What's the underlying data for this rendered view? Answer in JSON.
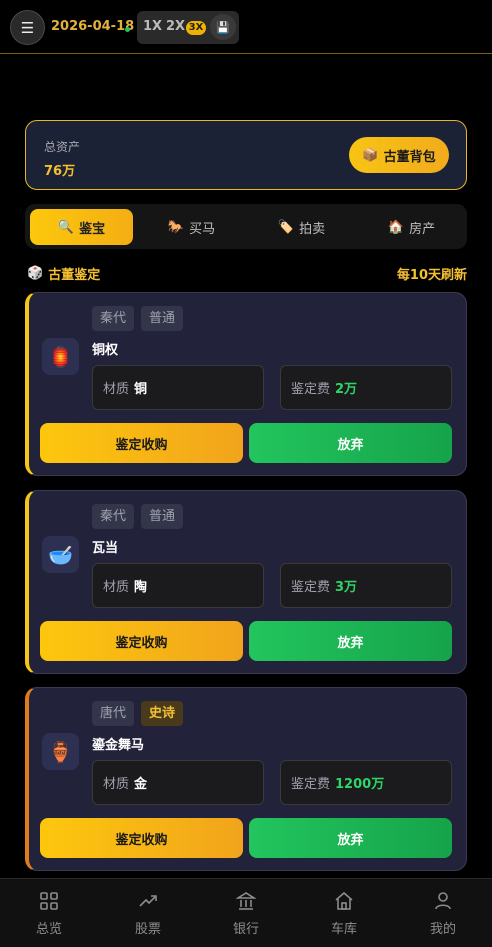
{
  "header": {
    "menu_icon": "hamburger-icon",
    "date": "2026-04-18",
    "status_color": "#22c55e",
    "speeds": [
      "1X",
      "2X",
      "3X"
    ],
    "active_speed": "3X",
    "save_icon": "floppy-disk-icon"
  },
  "assets": {
    "label": "总资产",
    "value": "76万",
    "bag_button": "古董背包",
    "bag_icon": "package-icon"
  },
  "tabs": [
    {
      "label": "鉴宝",
      "icon": "magnifier-icon",
      "active": true
    },
    {
      "label": "买马",
      "icon": "horse-icon",
      "active": false
    },
    {
      "label": "拍卖",
      "icon": "price-tag-icon",
      "active": false
    },
    {
      "label": "房产",
      "icon": "house-icon",
      "active": false
    }
  ],
  "section": {
    "title": "古董鉴定",
    "title_icon": "dice-icon",
    "refresh": "每10天刷新"
  },
  "items": [
    {
      "era": "秦代",
      "grade": "普通",
      "name": "铜权",
      "icon": "lantern-icon",
      "material_label": "材质",
      "material": "铜",
      "fee_label": "鉴定费",
      "fee": "2万",
      "buy_label": "鉴定收购",
      "skip_label": "放弃"
    },
    {
      "era": "秦代",
      "grade": "普通",
      "name": "瓦当",
      "icon": "bowl-icon",
      "material_label": "材质",
      "material": "陶",
      "fee_label": "鉴定费",
      "fee": "3万",
      "buy_label": "鉴定收购",
      "skip_label": "放弃"
    },
    {
      "era": "唐代",
      "grade": "史诗",
      "name": "鎏金舞马",
      "icon": "amphora-icon",
      "material_label": "材质",
      "material": "金",
      "fee_label": "鉴定费",
      "fee": "1200万",
      "buy_label": "鉴定收购",
      "skip_label": "放弃"
    }
  ],
  "nav": [
    {
      "label": "总览",
      "icon": "grid-icon"
    },
    {
      "label": "股票",
      "icon": "trend-up-icon"
    },
    {
      "label": "银行",
      "icon": "bank-icon"
    },
    {
      "label": "车库",
      "icon": "garage-icon"
    },
    {
      "label": "我的",
      "icon": "user-icon"
    }
  ]
}
